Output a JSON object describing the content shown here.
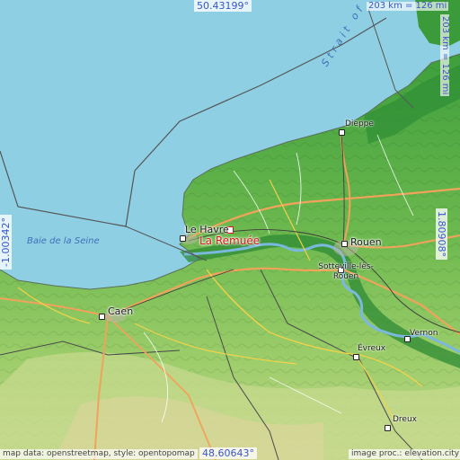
{
  "map": {
    "coords": {
      "north": "50.43199°",
      "south": "48.60643°",
      "west": "-1.00342°",
      "east": "1.80908°"
    },
    "scale": {
      "top": "203 km = 126 mi",
      "right": "203 km = 126 mi"
    },
    "target": {
      "name": "La Remuée"
    },
    "cities": {
      "le_havre": "Le Havre",
      "rouen": "Rouen",
      "caen": "Caen",
      "dieppe": "Dieppe",
      "sotteville": "Sotteville-lès-Rouen",
      "evreux": "Évreux",
      "vernon": "Vernon",
      "dreux": "Dreux"
    },
    "water": {
      "baie": "Baie de la Seine",
      "strait": "Strait of"
    },
    "credits": {
      "left": "map data: openstreetmap, style: opentopomap",
      "right": "image proc.: elevation.city"
    },
    "colors": {
      "sea": "#8ecfe3",
      "lowland": "#2f9a3c",
      "upland": "#a7d36e",
      "highland": "#d9d69a",
      "target": "#d91a1a",
      "coords": "#3a56c9"
    }
  }
}
